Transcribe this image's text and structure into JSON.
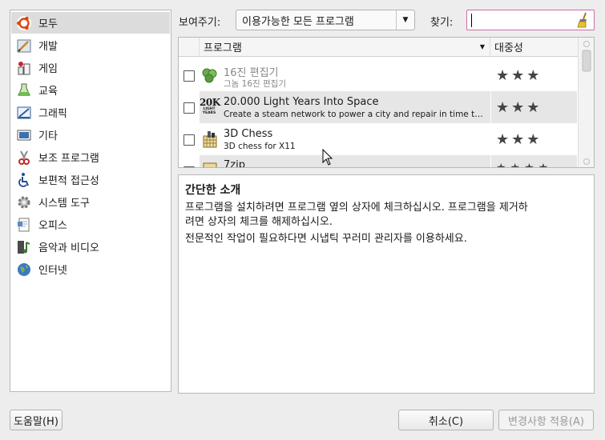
{
  "sidebar": {
    "items": [
      {
        "label": "모두",
        "icon": "ubuntu-logo-icon",
        "selected": true
      },
      {
        "label": "개발",
        "icon": "development-icon"
      },
      {
        "label": "게임",
        "icon": "games-icon"
      },
      {
        "label": "교육",
        "icon": "education-icon"
      },
      {
        "label": "그래픽",
        "icon": "graphics-icon"
      },
      {
        "label": "기타",
        "icon": "other-icon"
      },
      {
        "label": "보조 프로그램",
        "icon": "accessories-icon"
      },
      {
        "label": "보편적 접근성",
        "icon": "accessibility-icon"
      },
      {
        "label": "시스템 도구",
        "icon": "system-tools-icon"
      },
      {
        "label": "오피스",
        "icon": "office-icon"
      },
      {
        "label": "음악과 비디오",
        "icon": "music-video-icon"
      },
      {
        "label": "인터넷",
        "icon": "internet-icon"
      }
    ]
  },
  "toolbar": {
    "show_label": "보여주기:",
    "show_value": "이용가능한 모든 프로그램",
    "search_label": "찾기:",
    "search_value": ""
  },
  "table": {
    "columns": [
      "프로그램",
      "대중성"
    ],
    "rows": [
      {
        "name": "16진 편집기",
        "description": "그놈 16진 편집기",
        "icon": "hex-editor-icon",
        "checked": false,
        "popularity": 3,
        "dimmed": true
      },
      {
        "name": "20.000 Light Years Into Space",
        "description": "Create a steam network to power a city and repair in time the da…",
        "icon": "20k-logo-icon",
        "logo_text": "20K",
        "logo_subtext": "LIGHT YEARS",
        "checked": false,
        "popularity": 3
      },
      {
        "name": "3D Chess",
        "description": "3D chess for X11",
        "icon": "chess-icon",
        "checked": false,
        "popularity": 3
      },
      {
        "name": "7zip",
        "description": "",
        "icon": "archive-icon",
        "checked": false,
        "popularity": 4
      }
    ]
  },
  "description": {
    "title": "간단한 소개",
    "line1": "프로그램을 설치하려면 프로그램 옆의 상자에 체크하십시오. 프로그램을 제거하",
    "line2": "려면 상자의 체크를 해제하십시오.",
    "line3": "전문적인 작업이 필요하다면 시냅틱 꾸러미 관리자를 이용하세요."
  },
  "buttons": {
    "help": "도움말(H)",
    "cancel": "취소(C)",
    "apply": "변경사항 적용(A)"
  }
}
